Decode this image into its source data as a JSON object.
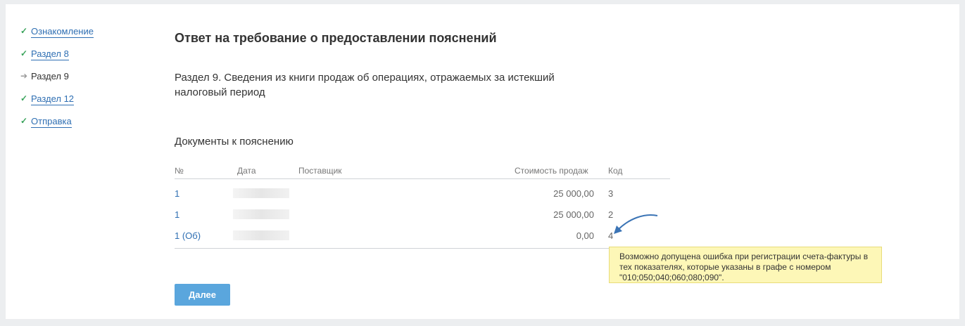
{
  "sidebar": {
    "items": [
      {
        "label": "Ознакомление",
        "state": "done"
      },
      {
        "label": "Раздел 8",
        "state": "done"
      },
      {
        "label": "Раздел 9",
        "state": "current"
      },
      {
        "label": "Раздел 12",
        "state": "done"
      },
      {
        "label": "Отправка",
        "state": "done"
      }
    ]
  },
  "main": {
    "title": "Ответ на требование о предоставлении пояснений",
    "section_text": "Раздел 9. Сведения из книги продаж об операциях, отражаемых за истекший налоговый период",
    "docs_title": "Документы к пояснению",
    "table": {
      "headers": {
        "num": "№",
        "date": "Дата",
        "supplier": "Поставщик",
        "amount": "Стоимость продаж",
        "code": "Код"
      },
      "rows": [
        {
          "num": "1",
          "amount": "25 000,00",
          "code": "3"
        },
        {
          "num": "1",
          "amount": "25 000,00",
          "code": "2"
        },
        {
          "num": "1 (Об)",
          "amount": "0,00",
          "code": "4"
        }
      ]
    },
    "tooltip": "Возможно допущена ошибка при регистрации счета-фактуры в тех показателях, которые указаны в графе с номером \"010;050;040;060;080;090\".",
    "next_button": "Далее"
  },
  "colors": {
    "link": "#2f6fb3",
    "check": "#3aa35b",
    "button": "#5aa6dd",
    "tooltip_bg": "#fdf7b7"
  }
}
